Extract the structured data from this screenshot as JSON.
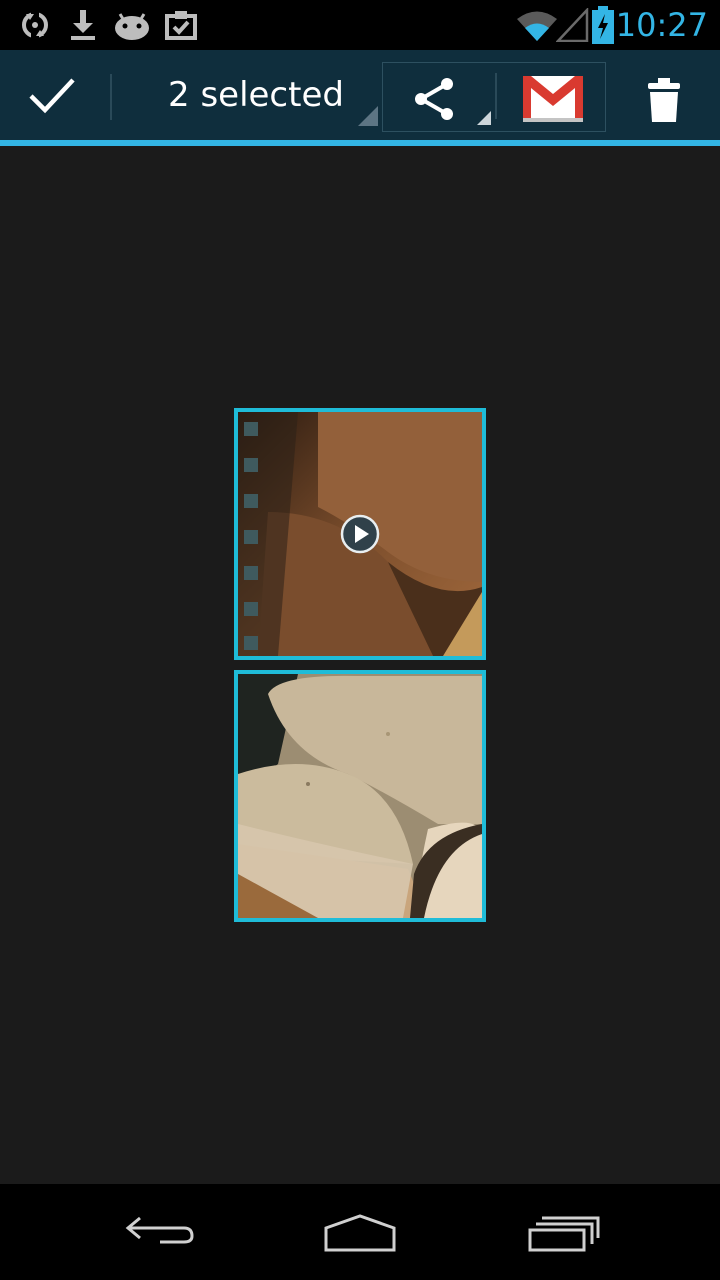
{
  "status_bar": {
    "time": "10:27",
    "icons": [
      "sync-icon",
      "download-icon",
      "android-icon",
      "clipboard-check-icon",
      "wifi-icon",
      "signal-icon",
      "battery-charging-icon"
    ]
  },
  "action_bar": {
    "selection_label": "2 selected",
    "actions": [
      "done-check-icon",
      "share-icon",
      "gmail-icon",
      "trash-icon"
    ]
  },
  "grid": {
    "items": [
      {
        "type": "video",
        "selected": true,
        "overlay": "play-icon"
      },
      {
        "type": "photo",
        "selected": true
      }
    ]
  },
  "nav_bar": {
    "buttons": [
      "back-icon",
      "home-icon",
      "recent-apps-icon"
    ]
  },
  "colors": {
    "accent": "#33b5e5",
    "selection_border": "#1fbcd8",
    "action_bar_bg": "#0f2e3d",
    "background": "#1b1b1b"
  }
}
